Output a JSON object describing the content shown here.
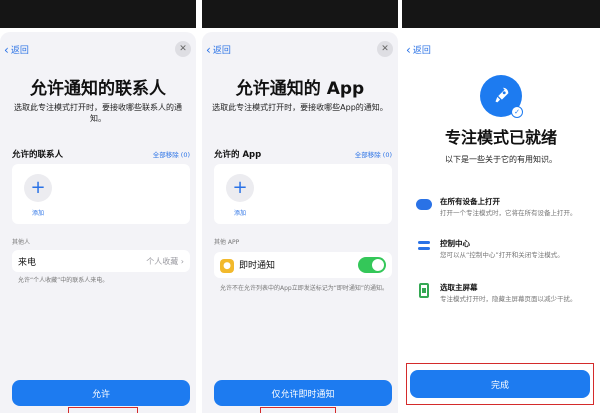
{
  "common": {
    "back_label": "返回",
    "close_glyph": "✕",
    "back_chevron": "‹",
    "add_glyph": "+"
  },
  "screen1": {
    "title": "允许通知的联系人",
    "description": "选取此专注模式打开时，要接收哪些联系人的通知。",
    "section_heading": "允许的联系人",
    "remove_all_label": "全部移除 (0)",
    "add_label": "添加",
    "group_label": "其他人",
    "row_label": "来电",
    "row_value": "个人收藏",
    "row_chevron": "›",
    "footnote": "允许“个人收藏”中的联系人来电。",
    "primary_button": "允许"
  },
  "screen2": {
    "title": "允许通知的 App",
    "description": "选取此专注模式打开时，要接收哪些App的通知。",
    "section_heading": "允许的 App",
    "remove_all_label": "全部移除 (0)",
    "add_label": "添加",
    "group_label": "其他 APP",
    "row_label": "即时通知",
    "row_toggle_on": true,
    "footnote": "允许不在允许列表中的App立即发送标记为“即时通知”的通知。",
    "primary_button": "仅允许即时通知"
  },
  "screen3": {
    "title": "专注模式已就绪",
    "description": "以下是一些关于它的有用知识。",
    "features": [
      {
        "icon": "cloud-icon",
        "title": "在所有设备上打开",
        "detail": "打开一个专注模式时，它将在所有设备上打开。"
      },
      {
        "icon": "control-center-icon",
        "title": "控制中心",
        "detail": "您可以从“控制中心”打开和关闭专注模式。"
      },
      {
        "icon": "home-screen-icon",
        "title": "选取主屏幕",
        "detail": "专注模式打开时，隐藏主屏幕页面以减少干扰。"
      }
    ],
    "primary_button": "完成"
  },
  "colors": {
    "accent": "#1d7bf0",
    "toggle_on": "#34c759",
    "highlight": "#d42b2b"
  }
}
